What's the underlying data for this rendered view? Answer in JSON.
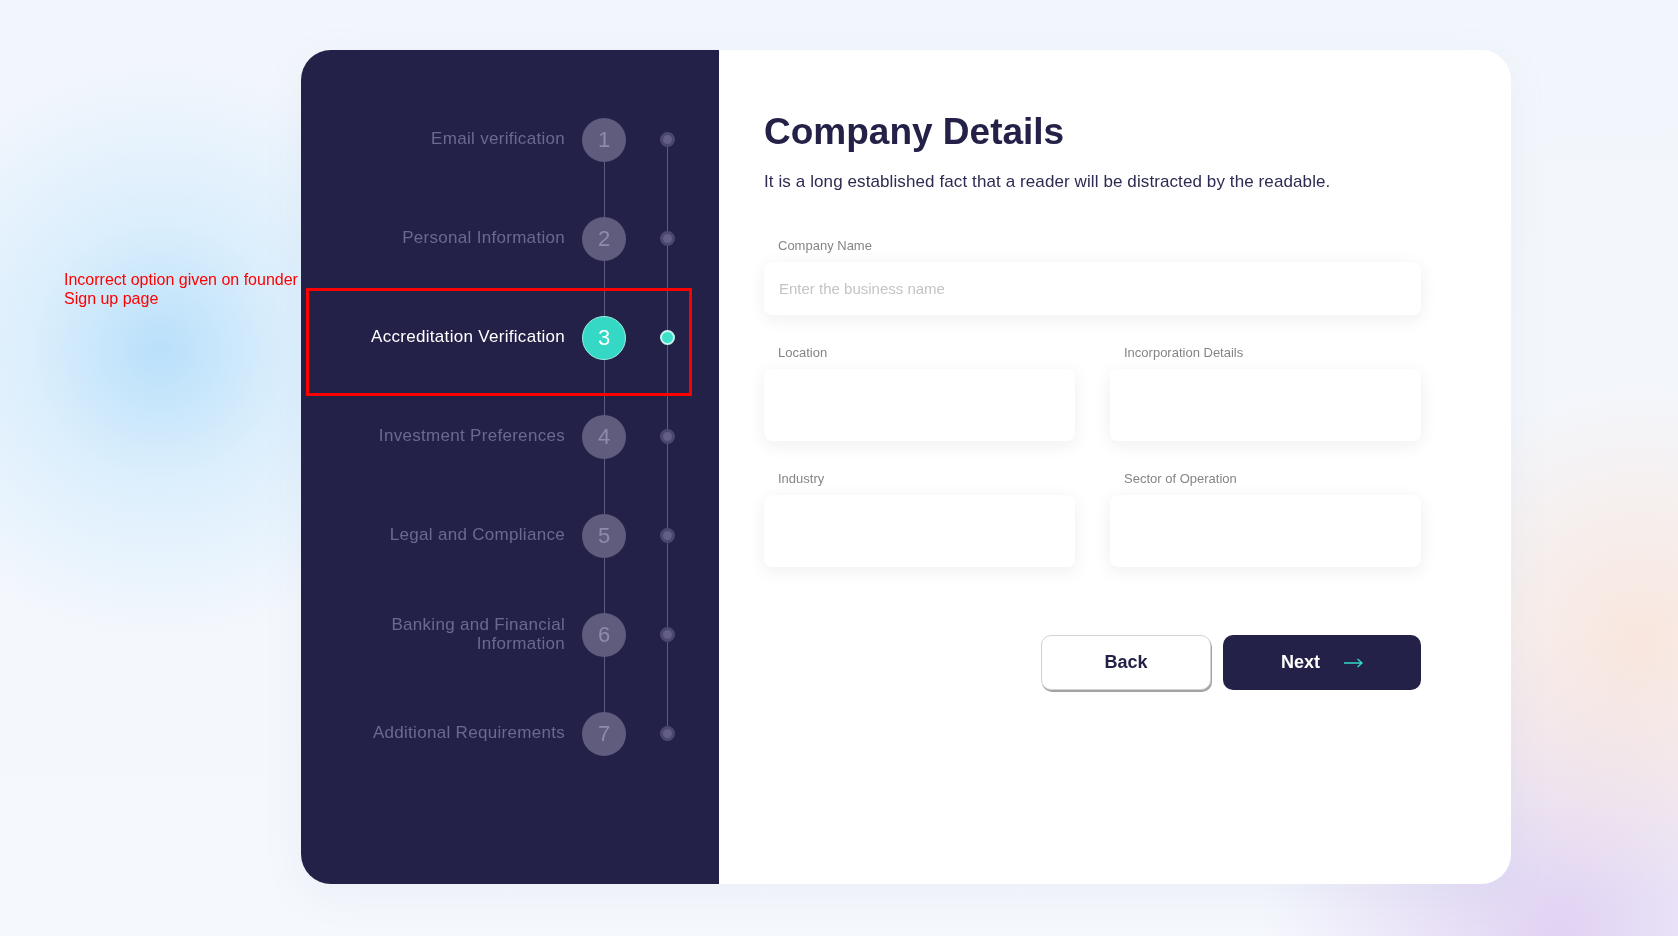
{
  "annotation": {
    "text": "Incorrect option given on founder Sign up page"
  },
  "steps": [
    {
      "number": "1",
      "label": "Email verification",
      "selected": false,
      "highlighted": false
    },
    {
      "number": "2",
      "label": "Personal Information",
      "selected": false,
      "highlighted": false
    },
    {
      "number": "3",
      "label": "Accreditation Verification",
      "selected": true,
      "highlighted": true
    },
    {
      "number": "4",
      "label": "Investment Preferences",
      "selected": false,
      "highlighted": false
    },
    {
      "number": "5",
      "label": "Legal and Compliance",
      "selected": false,
      "highlighted": false
    },
    {
      "number": "6",
      "label": "Banking and Financial Information",
      "selected": false,
      "highlighted": false
    },
    {
      "number": "7",
      "label": "Additional Requirements",
      "selected": false,
      "highlighted": false
    }
  ],
  "form": {
    "title": "Company Details",
    "description": "It is a long established fact that a reader will be distracted by the readable.",
    "fields": [
      {
        "label": "Company Name",
        "placeholder": "Enter the business name",
        "kind": "wide"
      },
      {
        "label": "Location",
        "kind": "half"
      },
      {
        "label": "Incorporation Details",
        "kind": "half"
      },
      {
        "label": "Industry",
        "kind": "half"
      },
      {
        "label": "Sector of Operation",
        "kind": "half"
      }
    ]
  },
  "buttons": [
    {
      "label": "Back",
      "kind": "secondary"
    },
    {
      "label": "Next",
      "kind": "primary"
    }
  ]
}
